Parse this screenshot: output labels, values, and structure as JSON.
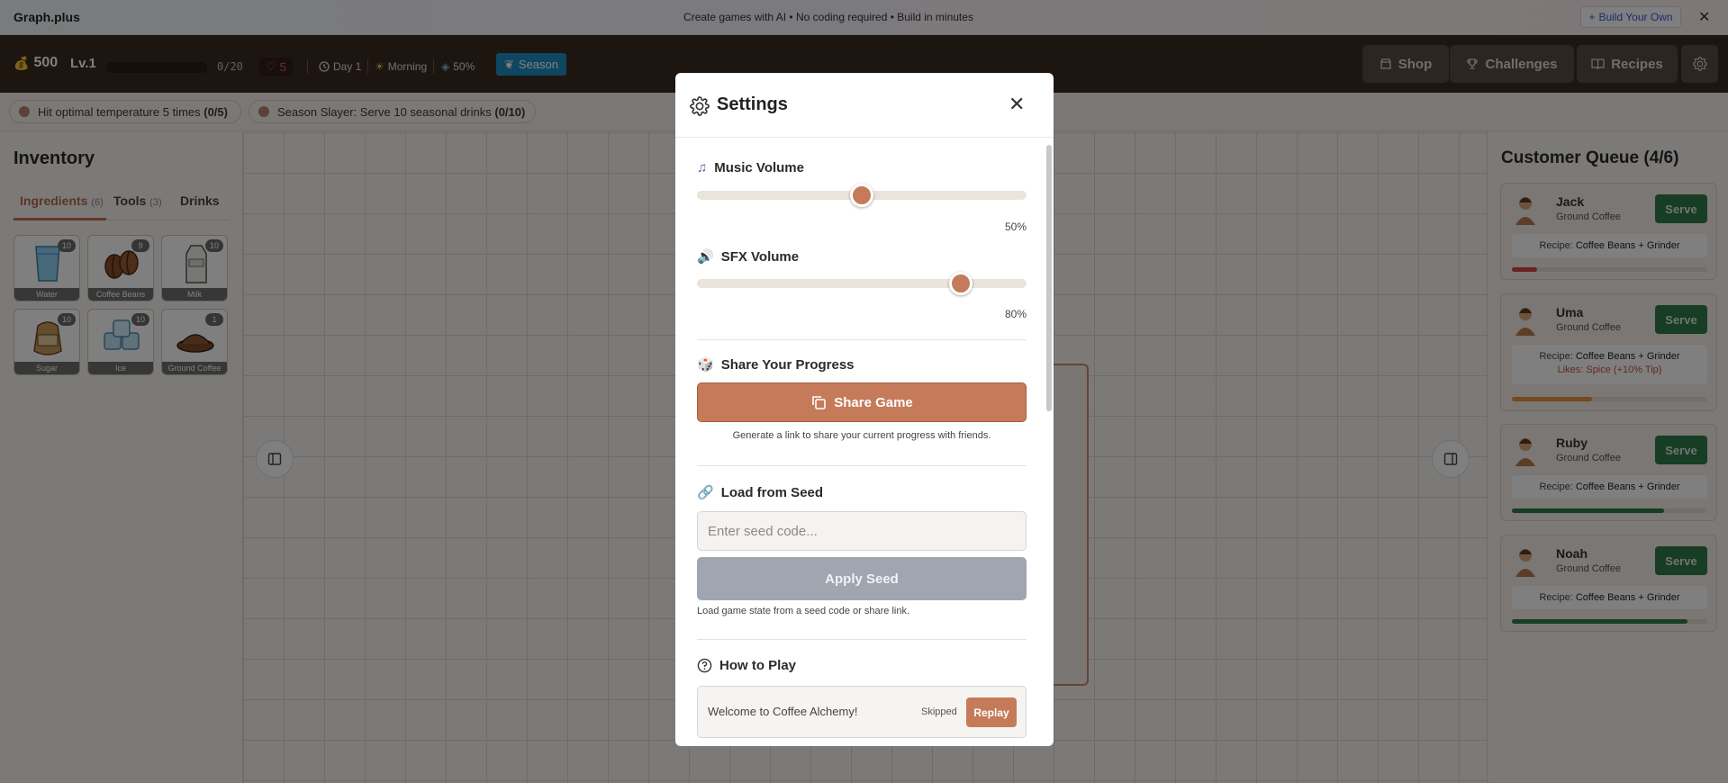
{
  "banner": {
    "brand": "Graph.plus",
    "tagline": "Create games with AI • No coding required • Build in minutes",
    "build_button": "Build Your Own",
    "close_icon": "close-icon"
  },
  "header": {
    "coins": "500",
    "level": "Lv.1",
    "xp": "0/20",
    "xp_progress": 0,
    "hearts": "5",
    "day": "Day 1",
    "time_of_day": "Morning",
    "percent": "50%",
    "season_button": "Season",
    "shop_button": "Shop",
    "challenges_button": "Challenges",
    "recipes_button": "Recipes",
    "settings_icon": "gear-icon"
  },
  "challenges": [
    {
      "text": "Hit optimal temperature 5 times ",
      "progress": "(0/5)"
    },
    {
      "text": "Season Slayer: Serve 10 seasonal drinks ",
      "progress": "(0/10)"
    }
  ],
  "inventory": {
    "title": "Inventory",
    "tabs": [
      {
        "label": "Ingredients",
        "count": "(6)"
      },
      {
        "label": "Tools",
        "count": "(3)"
      },
      {
        "label": "Drinks",
        "count": ""
      }
    ],
    "items": [
      {
        "name": "Water",
        "count": "10",
        "icon": "water-glass-icon"
      },
      {
        "name": "Coffee Beans",
        "count": "9",
        "icon": "coffee-beans-icon"
      },
      {
        "name": "Milk",
        "count": "10",
        "icon": "milk-carton-icon"
      },
      {
        "name": "Sugar",
        "count": "10",
        "icon": "sugar-sack-icon"
      },
      {
        "name": "Ice",
        "count": "10",
        "icon": "ice-cubes-icon"
      },
      {
        "name": "Ground Coffee",
        "count": "1",
        "icon": "ground-coffee-icon"
      }
    ]
  },
  "queue": {
    "title": "Customer Queue (4/6)",
    "customers": [
      {
        "name": "Jack",
        "order": "Ground Coffee",
        "serve": "Serve",
        "recipe_label": "Recipe: ",
        "recipe": "Coffee Beans + Grinder",
        "likes": "",
        "patience": 0.13,
        "color": "#d64545"
      },
      {
        "name": "Uma",
        "order": "Ground Coffee",
        "serve": "Serve",
        "recipe_label": "Recipe: ",
        "recipe": "Coffee Beans + Grinder",
        "likes": "Likes: Spice (+10% Tip)",
        "patience": 0.41,
        "color": "#e8953c"
      },
      {
        "name": "Ruby",
        "order": "Ground Coffee",
        "serve": "Serve",
        "recipe_label": "Recipe: ",
        "recipe": "Coffee Beans + Grinder",
        "likes": "",
        "patience": 0.78,
        "color": "#2f7a4a"
      },
      {
        "name": "Noah",
        "order": "Ground Coffee",
        "serve": "Serve",
        "recipe_label": "Recipe: ",
        "recipe": "Coffee Beans + Grinder",
        "likes": "",
        "patience": 0.9,
        "color": "#2f7a4a"
      }
    ]
  },
  "settings": {
    "title": "Settings",
    "music_label": "Music Volume",
    "music_value": 50,
    "music_pct": "50%",
    "sfx_label": "SFX Volume",
    "sfx_value": 80,
    "sfx_pct": "80%",
    "share_title": "Share Your Progress",
    "share_button": "Share Game",
    "share_help": "Generate a link to share your current progress with friends.",
    "seed_title": "Load from Seed",
    "seed_placeholder": "Enter seed code...",
    "seed_value": "",
    "apply_button": "Apply Seed",
    "seed_help": "Load game state from a seed code or share link.",
    "howto_title": "How to Play",
    "howto_item": "Welcome to Coffee Alchemy!",
    "howto_status": "Skipped",
    "howto_replay": "Replay"
  }
}
